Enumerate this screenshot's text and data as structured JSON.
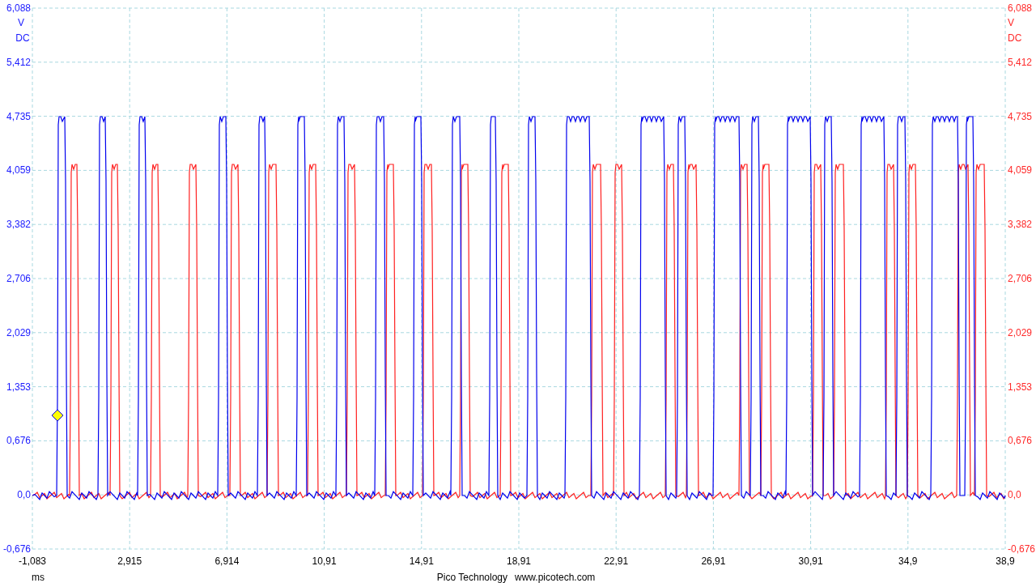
{
  "chart": {
    "left_axis": {
      "ticks": [
        "6,088",
        "5,412",
        "4,735",
        "4,059",
        "3,382",
        "2,706",
        "2,029",
        "1,353",
        "0,676",
        "0,0",
        "-0,676"
      ],
      "unit": "V",
      "coupling": "DC"
    },
    "right_axis": {
      "ticks": [
        "6,088",
        "5,412",
        "4,735",
        "4,059",
        "3,382",
        "2,706",
        "2,029",
        "1,353",
        "0,676",
        "0,0",
        "-0,676"
      ],
      "unit": "V",
      "coupling": "DC"
    },
    "x_axis": {
      "ticks": [
        "-1,083",
        "2,915",
        "6,914",
        "10,91",
        "14,91",
        "18,91",
        "22,91",
        "26,91",
        "30,91",
        "34,9",
        "38,9"
      ],
      "unit": "ms"
    }
  },
  "footer": {
    "company": "Pico Technology",
    "website": "www.picotech.com"
  }
}
